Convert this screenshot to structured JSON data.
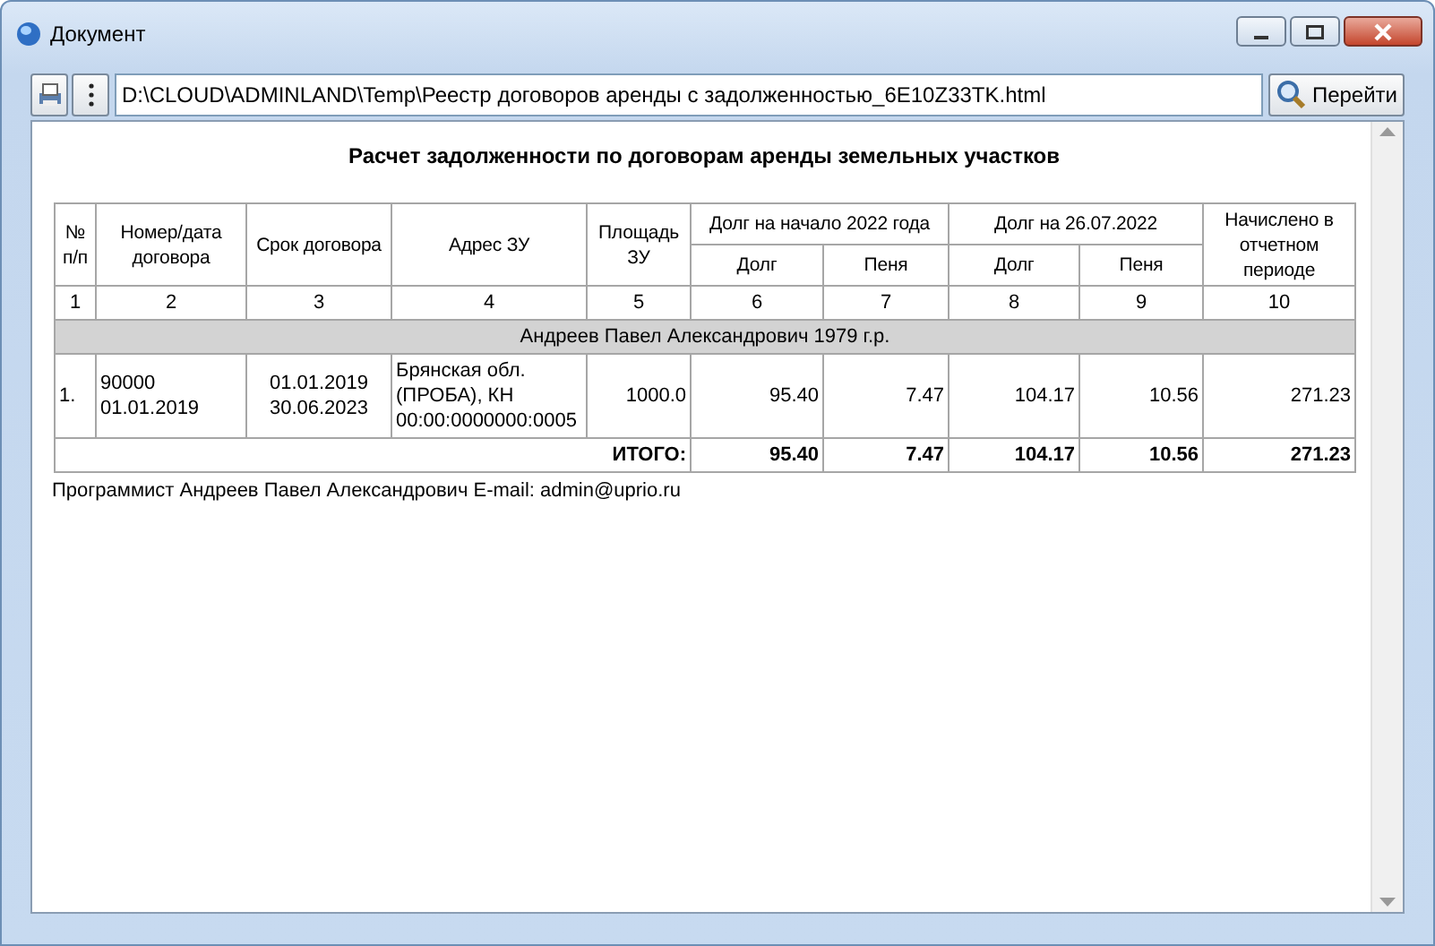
{
  "window": {
    "title": "Документ"
  },
  "toolbar": {
    "address": "D:\\CLOUD\\ADMINLAND\\Temp\\Реестр договоров аренды с задолженностью_6E10Z33TK.html",
    "go_button": "Перейти"
  },
  "report": {
    "title": "Расчет задолженности по договорам аренды земельных участков",
    "columns": [
      {
        "label": "№\nп/п"
      },
      {
        "label": "Номер/дата\nдоговора"
      },
      {
        "label": "Срок договора"
      },
      {
        "label": "Адрес ЗУ"
      },
      {
        "label": "Площадь\nЗУ"
      },
      {
        "label": "Долг на начало 2022 года",
        "colspan": 2,
        "subcolumns": [
          "Долг",
          "Пеня"
        ]
      },
      {
        "label": "Долг на 26.07.2022",
        "colspan": 2,
        "subcolumns": [
          "Долг",
          "Пеня"
        ]
      },
      {
        "label": "Начислено в\nотчетном\nпериоде"
      }
    ],
    "column_numbers": [
      "1",
      "2",
      "3",
      "4",
      "5",
      "6",
      "7",
      "8",
      "9",
      "10"
    ],
    "group": "Андреев Павел Александрович 1979 г.р.",
    "rows": [
      {
        "cells": [
          "1.",
          "90000\n01.01.2019",
          "01.01.2019\n30.06.2023",
          "Брянская обл.\n(ПРОБА), КН\n00:00:0000000:0005",
          "1000.0",
          "95.40",
          "7.47",
          "104.17",
          "10.56",
          "271.23"
        ]
      }
    ],
    "total": {
      "label": "ИТОГО:",
      "values": [
        "95.40",
        "7.47",
        "104.17",
        "10.56",
        "271.23"
      ]
    },
    "footer": "Программист Андреев Павел Александрович E-mail: admin@uprio.ru"
  }
}
